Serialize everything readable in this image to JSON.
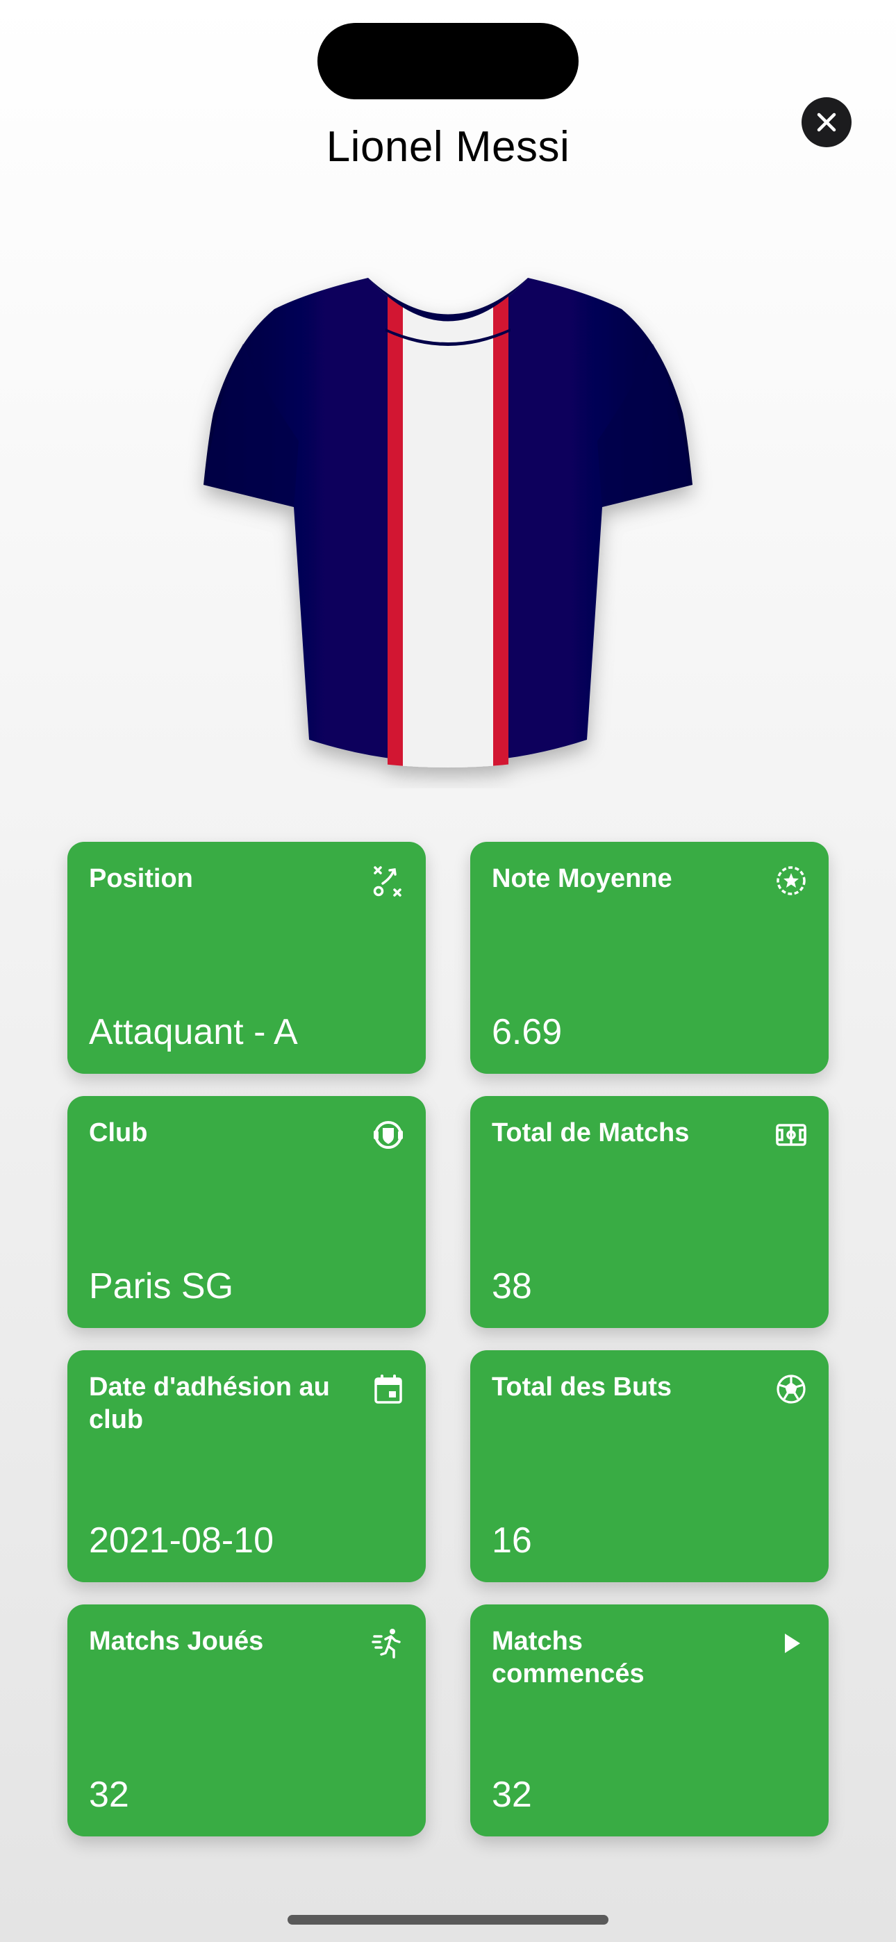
{
  "header": {
    "player_name": "Lionel Messi",
    "close_icon": "xmark-icon"
  },
  "jersey": {
    "body_color": "#07045c",
    "stripe_color": "#f2f2f2",
    "trim_color": "#d21830"
  },
  "stats": {
    "position": {
      "title": "Position",
      "value": "Attaquant - A",
      "icon": "strategy-icon"
    },
    "rating": {
      "title": "Note Moyenne",
      "value": "6.69",
      "icon": "star-circle-icon"
    },
    "club": {
      "title": "Club",
      "value": "Paris SG",
      "icon": "club-badge-icon"
    },
    "total_matches": {
      "title": "Total de Matchs",
      "value": "38",
      "icon": "stadium-icon"
    },
    "join_date": {
      "title": "Date d'adhésion au club",
      "value": "2021-08-10",
      "icon": "calendar-icon"
    },
    "total_goals": {
      "title": "Total des Buts",
      "value": "16",
      "icon": "soccer-ball-icon"
    },
    "matches_played": {
      "title": "Matchs Joués",
      "value": "32",
      "icon": "running-player-icon"
    },
    "matches_started": {
      "title": "Matchs commencés",
      "value": "32",
      "icon": "play-icon"
    }
  },
  "colors": {
    "card_background": "#39ac44",
    "card_text": "#ffffff",
    "close_button": "#1c1c1e"
  }
}
